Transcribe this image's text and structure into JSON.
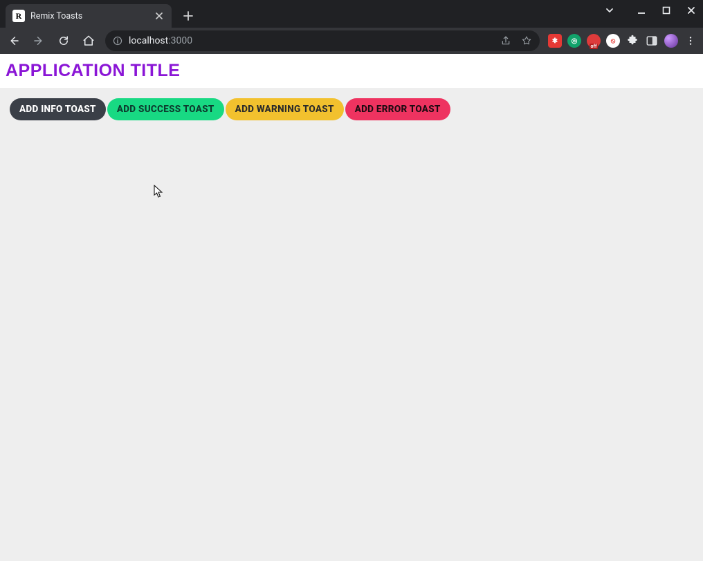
{
  "browser": {
    "tab_title": "Remix Toasts",
    "favicon_letter": "R",
    "url_host": "localhost",
    "url_port": ":3000"
  },
  "page": {
    "app_title": "APPLICATION TITLE",
    "buttons": {
      "info": "ADD INFO TOAST",
      "success": "ADD SUCCESS TOAST",
      "warning": "ADD WARNING TOAST",
      "error": "ADD ERROR TOAST"
    }
  },
  "colors": {
    "title": "#8a15d6",
    "info_bg": "#3a3f47",
    "success_bg": "#18d983",
    "warning_bg": "#f2c12e",
    "error_bg": "#ee3360",
    "page_bg": "#eeeeee"
  }
}
